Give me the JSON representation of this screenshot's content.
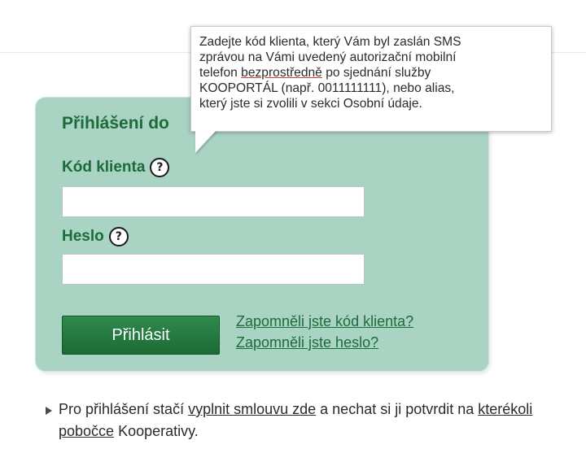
{
  "login": {
    "title": "Přihlášení do",
    "client_code_label": "Kód klienta",
    "password_label": "Heslo",
    "client_code_value": "",
    "password_value": "",
    "submit_label": "Přihlásit",
    "forgot_code_link": "Zapomněli jste kód klienta?",
    "forgot_password_link": "Zapomněli jste heslo?"
  },
  "tooltip": {
    "line1": "Zadejte kód klienta, který Vám byl zaslán SMS",
    "line2": "zprávou na Vámi uvedený autorizační mobilní",
    "line3_before": "telefon ",
    "line3_underlined": "bezprostředně",
    "line3_after": " po sjednání služby",
    "line4": "KOOPORTÁL (např. 0011111111), nebo alias,",
    "line5": "který jste si zvolili v sekci Osobní údaje."
  },
  "info": {
    "text_before": "Pro přihlášení stačí ",
    "link1": "vyplnit smlouvu zde",
    "text_middle": " a nechat si ji potvrdit na ",
    "link2": "kterékoli pobočce",
    "text_after": " Kooperativy."
  },
  "colors": {
    "panel": "#a9d3c2",
    "brand_green": "#1d6b3a",
    "button": "#1c6a35"
  },
  "icons": {
    "help": "question-circle-icon",
    "bullet": "triangle-right-icon"
  }
}
